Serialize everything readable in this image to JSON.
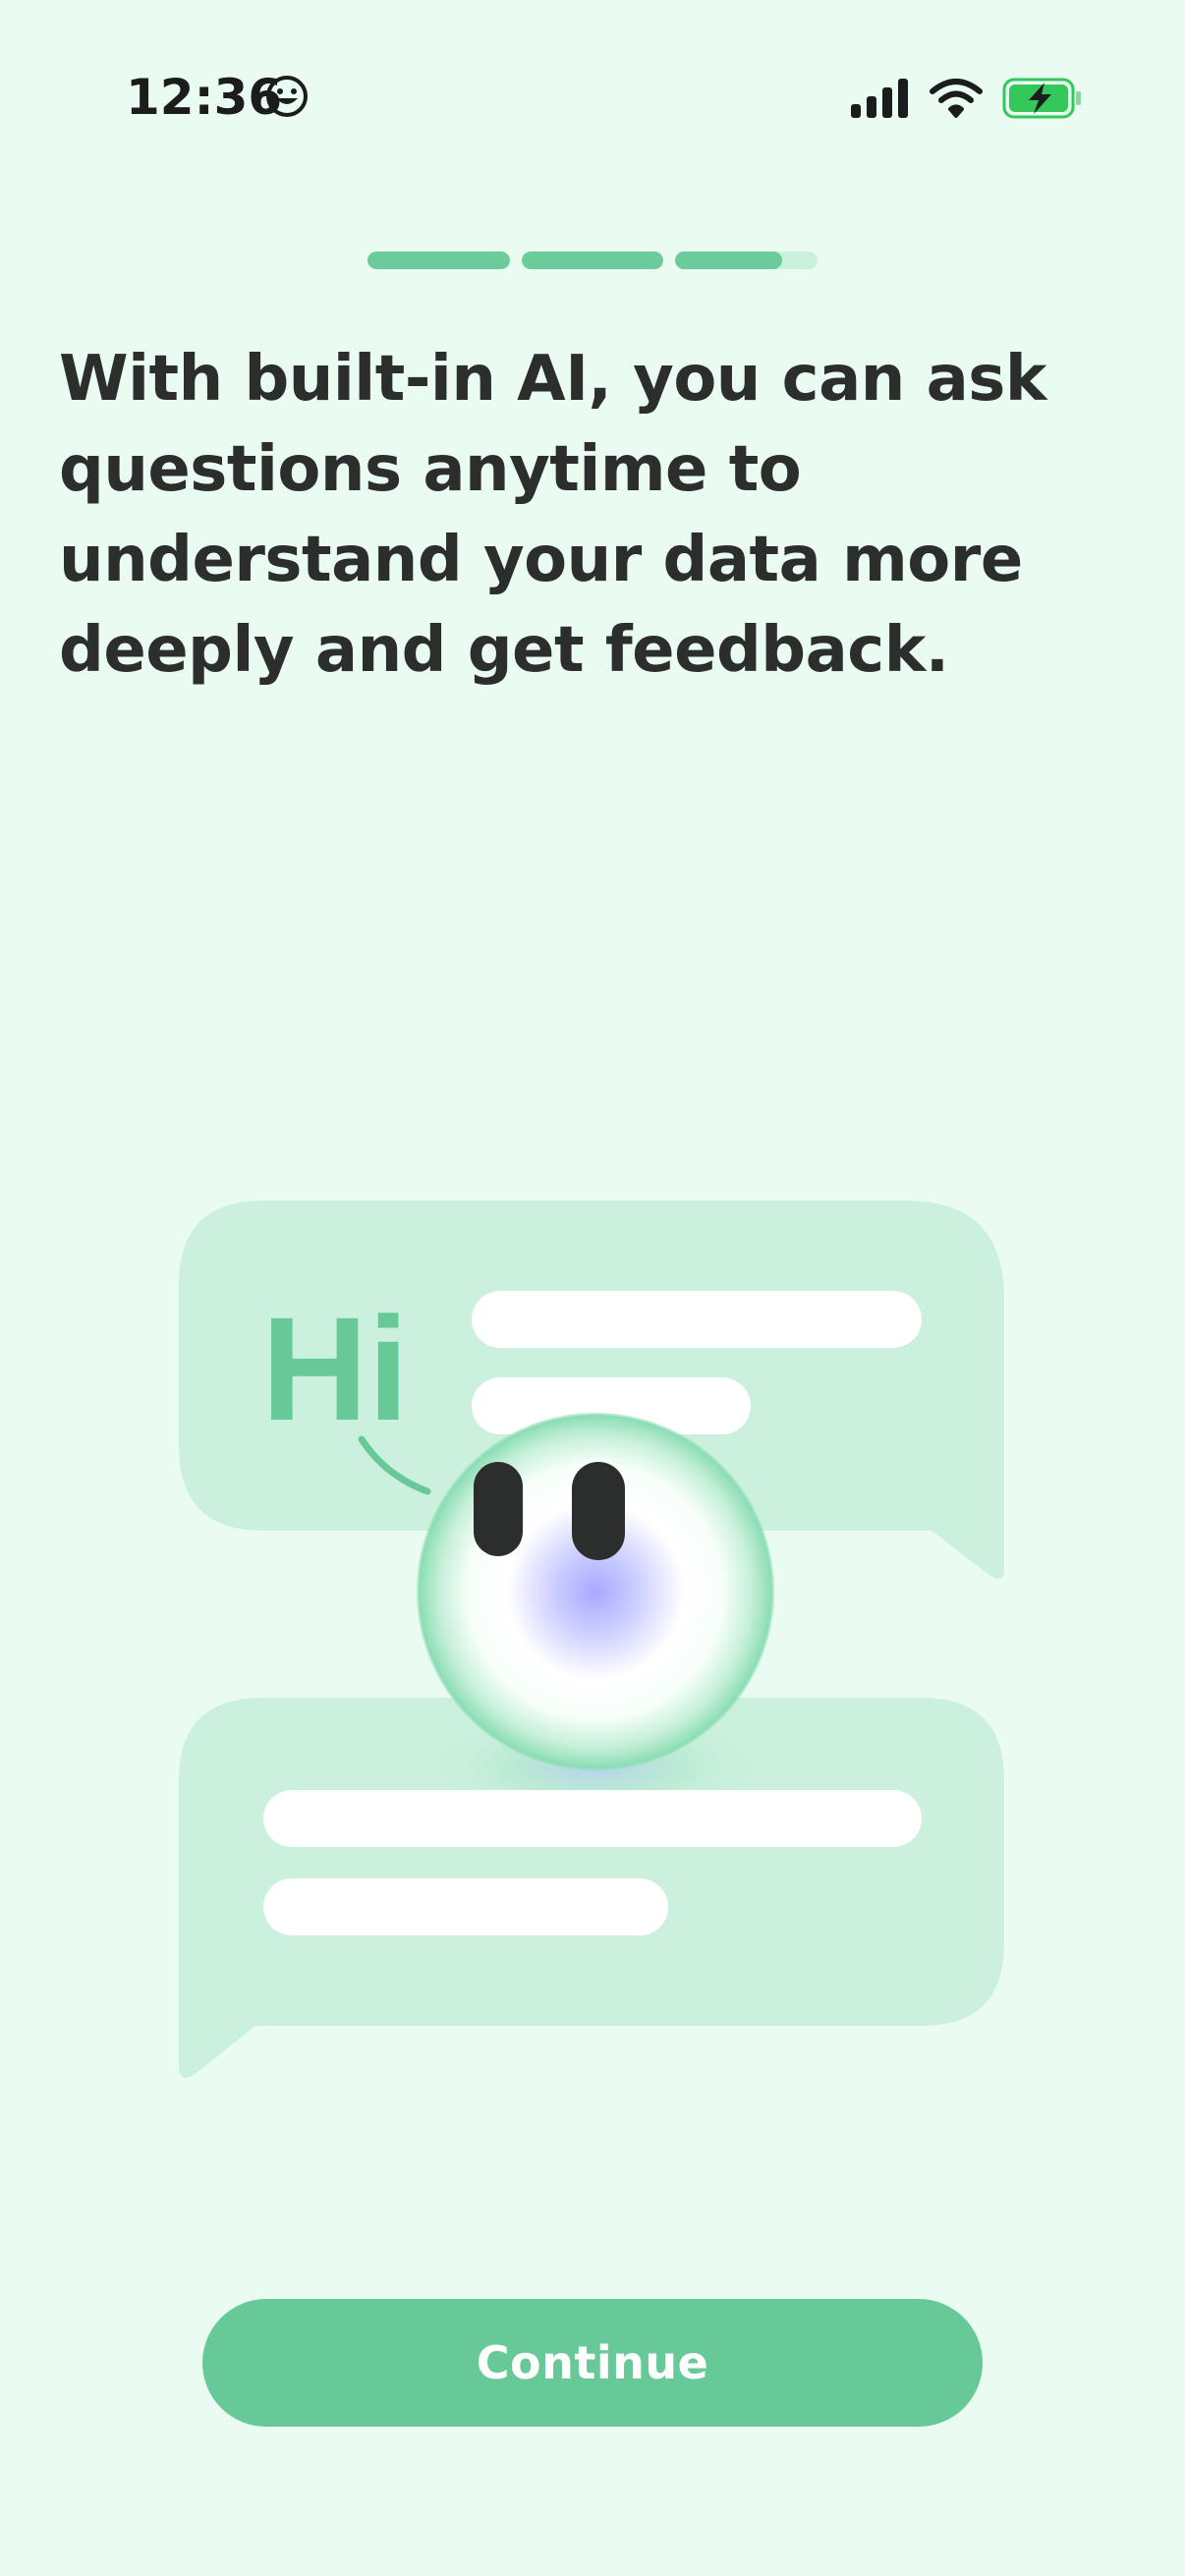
{
  "status_bar": {
    "time": "12:36",
    "emoji_icon": "smiley-face-icon",
    "signal_icon": "cellular-signal-icon",
    "wifi_icon": "wifi-icon",
    "battery_icon": "battery-charging-icon",
    "battery_color": "#34C759"
  },
  "onboarding": {
    "progress": {
      "segments": [
        1,
        1,
        0.75
      ]
    },
    "headline": "With built-in AI, you can ask questions anytime to understand your data more deeply and get feedback.",
    "illustration": {
      "greeting": "Hi",
      "mascot_icon": "ai-mascot-orb-icon"
    },
    "continue_label": "Continue"
  },
  "colors": {
    "background": "#EAFCF1",
    "accent": "#68C998",
    "bubble": "#CBF0DD",
    "text": "#2C2E2D"
  }
}
